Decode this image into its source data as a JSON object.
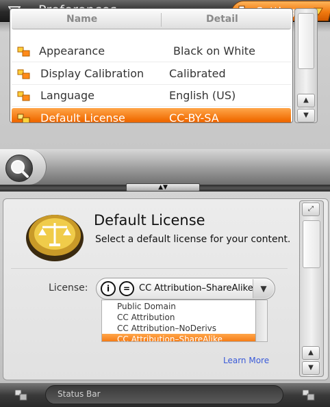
{
  "window": {
    "title": "Preferences",
    "settings_label": "Settings"
  },
  "list": {
    "headers": {
      "name": "Name",
      "detail": "Detail"
    },
    "rows": [
      {
        "name": "Appearance",
        "detail": "Black on White"
      },
      {
        "name": "Display Calibration",
        "detail": "Calibrated"
      },
      {
        "name": "Language",
        "detail": "English (US)"
      },
      {
        "name": "Default License",
        "detail": "CC-BY-SA",
        "selected": true
      }
    ]
  },
  "detail": {
    "title": "Default License",
    "subtitle": "Select a default license for your content.",
    "license_label": "License:",
    "selected_license": "CC Attribution–ShareAlike",
    "options": [
      "Public Domain",
      "CC Attribution",
      "CC Attribution–NoDerivs",
      "CC Attribution–ShareAlike"
    ],
    "learn_more": "Learn More"
  },
  "status": {
    "text": "Status Bar"
  },
  "colors": {
    "accent": "#f07a10",
    "link": "#3a5ad8"
  },
  "icons": [
    "menu-toggle-icon",
    "settings-icon",
    "chevron-down-icon",
    "pref-item-icon",
    "search-icon",
    "scales-badge-icon",
    "cc-by-icon",
    "cc-nd-icon",
    "expand-icon",
    "up-arrow-icon",
    "down-arrow-icon"
  ]
}
